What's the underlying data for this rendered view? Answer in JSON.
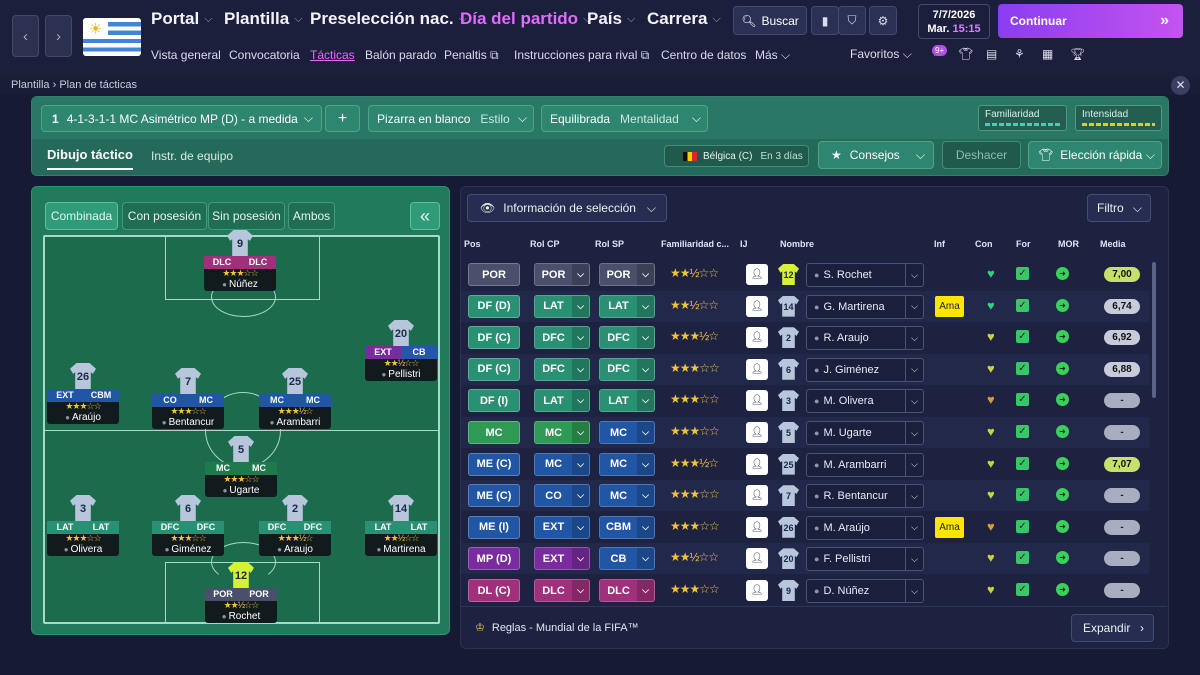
{
  "topnav": {
    "items": [
      {
        "label": "Portal",
        "active": false
      },
      {
        "label": "Plantilla",
        "active": false
      },
      {
        "label": "Preselección nac.",
        "active": false
      },
      {
        "label": "Día del partido",
        "active": true
      },
      {
        "label": "País",
        "active": false
      },
      {
        "label": "Carrera",
        "active": false
      }
    ],
    "subnav": [
      "Vista general",
      "Convocatoria",
      "Tácticas",
      "Balón parado",
      "Penaltis",
      "Instrucciones para rival",
      "Centro de datos",
      "Más"
    ],
    "search_label": "Buscar",
    "date": "7/7/2026",
    "day": "Mar.",
    "time": "15:15",
    "continue_label": "Continuar",
    "favorites_label": "Favoritos",
    "notif_badge": "9+",
    "accent": "#e26bff"
  },
  "breadcrumb": {
    "parent": "Plantilla",
    "current": "Plan de tácticas"
  },
  "tactic": {
    "number": "1",
    "name": "4-1-3-1-1 MC Asimétrico MP (D) - a medida",
    "add_label": "+",
    "style_value": "Pizarra en blanco",
    "style_label": "Estilo",
    "mentality_value": "Equilibrada",
    "mentality_label": "Mentalidad",
    "familiarity_label": "Familiaridad",
    "intensity_label": "Intensidad",
    "tabs": [
      "Dibujo táctico",
      "Instr. de equipo"
    ],
    "opponent": "Bélgica (C)",
    "opponent_when": "En 3 días",
    "advice_label": "Consejos",
    "undo_label": "Deshacer",
    "quick_pick_label": "Elección rápida"
  },
  "pitch": {
    "view_buttons": [
      "Combinada",
      "Con posesión",
      "Sin posesión",
      "Ambos"
    ],
    "players": [
      {
        "num": "9",
        "name": "Núñez",
        "roles": [
          "DLC",
          "DLC"
        ],
        "cls": [
          "cDL",
          "cDL"
        ],
        "stars": "★★★☆☆",
        "gk": false
      },
      {
        "num": "20",
        "name": "Pellistri",
        "roles": [
          "EXT",
          "CB"
        ],
        "cls": [
          "cMP",
          "cCB"
        ],
        "stars": "★★½☆☆",
        "gk": false
      },
      {
        "num": "26",
        "name": "Araújo",
        "roles": [
          "EXT",
          "CBM"
        ],
        "cls": [
          "cME",
          "cME"
        ],
        "stars": "★★★☆☆",
        "gk": false
      },
      {
        "num": "7",
        "name": "Bentancur",
        "roles": [
          "CO",
          "MC"
        ],
        "cls": [
          "cME",
          "cME"
        ],
        "stars": "★★★☆☆",
        "gk": false
      },
      {
        "num": "25",
        "name": "Arambarri",
        "roles": [
          "MC",
          "MC"
        ],
        "cls": [
          "cME",
          "cME"
        ],
        "stars": "★★★½☆",
        "gk": false
      },
      {
        "num": "5",
        "name": "Ugarte",
        "roles": [
          "MC",
          "MC"
        ],
        "cls": [
          "cMC",
          "cMC"
        ],
        "stars": "★★★☆☆",
        "gk": false
      },
      {
        "num": "3",
        "name": "Olivera",
        "roles": [
          "LAT",
          "LAT"
        ],
        "cls": [
          "cDF",
          "cDF"
        ],
        "stars": "★★★☆☆",
        "gk": false
      },
      {
        "num": "6",
        "name": "Giménez",
        "roles": [
          "DFC",
          "DFC"
        ],
        "cls": [
          "cDF",
          "cDF"
        ],
        "stars": "★★★☆☆",
        "gk": false
      },
      {
        "num": "2",
        "name": "Araujo",
        "roles": [
          "DFC",
          "DFC"
        ],
        "cls": [
          "cDF",
          "cDF"
        ],
        "stars": "★★★½☆",
        "gk": false
      },
      {
        "num": "14",
        "name": "Martirena",
        "roles": [
          "LAT",
          "LAT"
        ],
        "cls": [
          "cDF",
          "cDF"
        ],
        "stars": "★★½☆☆",
        "gk": false
      },
      {
        "num": "12",
        "name": "Rochet",
        "roles": [
          "POR",
          "POR"
        ],
        "cls": [
          "cPO",
          "cPO"
        ],
        "stars": "★★½☆☆",
        "gk": true
      }
    ]
  },
  "table": {
    "info_label": "Información de selección",
    "filter_label": "Filtro",
    "columns": [
      "Pos",
      "Rol CP",
      "Rol SP",
      "Familiaridad c...",
      "IJ",
      "Nombre",
      "Inf",
      "Con",
      "For",
      "MOR",
      "Media"
    ],
    "rows": [
      {
        "pos": "POR",
        "pc": "#4a4f6b",
        "cp": "POR",
        "cpc": "#4a4f6b",
        "sp": "POR",
        "spc": "#4a4f6b",
        "stars": "★★½☆☆",
        "num": "12",
        "gk": true,
        "name": "S. Rochet",
        "inf": "",
        "con": "#35d07f",
        "rating": "7,00",
        "rc": "g"
      },
      {
        "pos": "DF (D)",
        "pc": "#2a9073",
        "cp": "LAT",
        "cpc": "#2a9073",
        "sp": "LAT",
        "spc": "#2a9073",
        "stars": "★★½☆☆",
        "num": "14",
        "gk": false,
        "name": "G. Martirena",
        "inf": "Ama",
        "con": "#35d07f",
        "rating": "6,74",
        "rc": ""
      },
      {
        "pos": "DF (C)",
        "pc": "#2a9073",
        "cp": "DFC",
        "cpc": "#2a9073",
        "sp": "DFC",
        "spc": "#2a9073",
        "stars": "★★★½☆",
        "num": "2",
        "gk": false,
        "name": "R. Araujo",
        "inf": "",
        "con": "#c9d43a",
        "rating": "6,92",
        "rc": ""
      },
      {
        "pos": "DF (C)",
        "pc": "#2a9073",
        "cp": "DFC",
        "cpc": "#2a9073",
        "sp": "DFC",
        "spc": "#2a9073",
        "stars": "★★★☆☆",
        "num": "6",
        "gk": false,
        "name": "J. Giménez",
        "inf": "",
        "con": "#c9d43a",
        "rating": "6,88",
        "rc": ""
      },
      {
        "pos": "DF (I)",
        "pc": "#2a9073",
        "cp": "LAT",
        "cpc": "#2a9073",
        "sp": "LAT",
        "spc": "#2a9073",
        "stars": "★★★☆☆",
        "num": "3",
        "gk": false,
        "name": "M. Olivera",
        "inf": "",
        "con": "#d99a3a",
        "rating": "-",
        "rc": "n"
      },
      {
        "pos": "MC",
        "pc": "#2f9a55",
        "cp": "MC",
        "cpc": "#2f9a55",
        "sp": "MC",
        "spc": "#2156a5",
        "stars": "★★★☆☆",
        "num": "5",
        "gk": false,
        "name": "M. Ugarte",
        "inf": "",
        "con": "#c9d43a",
        "rating": "-",
        "rc": "n"
      },
      {
        "pos": "ME (C)",
        "pc": "#2156a5",
        "cp": "MC",
        "cpc": "#2156a5",
        "sp": "MC",
        "spc": "#2156a5",
        "stars": "★★★½☆",
        "num": "25",
        "gk": false,
        "name": "M. Arambarri",
        "inf": "",
        "con": "#c9d43a",
        "rating": "7,07",
        "rc": "g"
      },
      {
        "pos": "ME (C)",
        "pc": "#2156a5",
        "cp": "CO",
        "cpc": "#2156a5",
        "sp": "MC",
        "spc": "#2156a5",
        "stars": "★★★☆☆",
        "num": "7",
        "gk": false,
        "name": "R. Bentancur",
        "inf": "",
        "con": "#c9d43a",
        "rating": "-",
        "rc": "n"
      },
      {
        "pos": "ME (I)",
        "pc": "#2156a5",
        "cp": "EXT",
        "cpc": "#2156a5",
        "sp": "CBM",
        "spc": "#2156a5",
        "stars": "★★★☆☆",
        "num": "26",
        "gk": false,
        "name": "M. Araújo",
        "inf": "Ama",
        "con": "#d99a3a",
        "rating": "-",
        "rc": "n"
      },
      {
        "pos": "MP (D)",
        "pc": "#7a2c9e",
        "cp": "EXT",
        "cpc": "#7a2c9e",
        "sp": "CB",
        "spc": "#2156a5",
        "stars": "★★½☆☆",
        "num": "20",
        "gk": false,
        "name": "F. Pellistri",
        "inf": "",
        "con": "#c9d43a",
        "rating": "-",
        "rc": "n"
      },
      {
        "pos": "DL (C)",
        "pc": "#a0307c",
        "cp": "DLC",
        "cpc": "#a0307c",
        "sp": "DLC",
        "spc": "#a0307c",
        "stars": "★★★☆☆",
        "num": "9",
        "gk": false,
        "name": "D. Núñez",
        "inf": "",
        "con": "#c9d43a",
        "rating": "-",
        "rc": "n"
      }
    ],
    "rules_label": "Reglas - Mundial de la FIFA™",
    "expand_label": "Expandir"
  }
}
